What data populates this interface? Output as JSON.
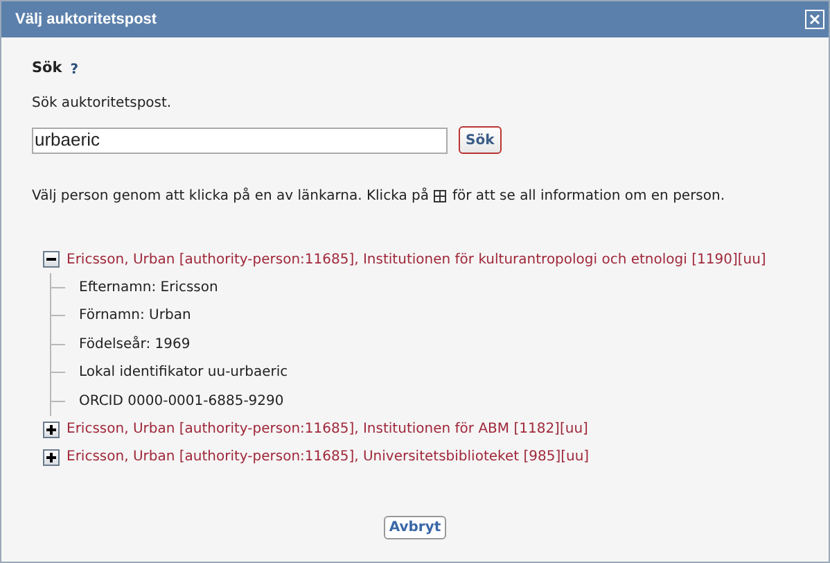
{
  "window": {
    "title": "Välj auktoritetspost"
  },
  "search": {
    "heading": "Sök",
    "help": "?",
    "description": "Sök auktoritetspost.",
    "value": "urbaeric",
    "button": "Sök"
  },
  "instruction": {
    "before": "Välj person genom att klicka på en av länkarna. Klicka på",
    "after": "för att se all information om en person."
  },
  "results": [
    {
      "label": "Ericsson, Urban [authority-person:11685], Institutionen för kulturantropologi och etnologi [1190][uu]",
      "expanded": true,
      "children": [
        "Efternamn: Ericsson",
        "Förnamn: Urban",
        "Födelseår: 1969",
        "Lokal identifikator uu-urbaeric",
        "ORCID 0000-0001-6885-9290"
      ]
    },
    {
      "label": "Ericsson, Urban [authority-person:11685], Institutionen för ABM [1182][uu]",
      "expanded": false
    },
    {
      "label": "Ericsson, Urban [authority-person:11685], Universitetsbiblioteket [985][uu]",
      "expanded": false
    }
  ],
  "cancel_button": "Avbryt"
}
